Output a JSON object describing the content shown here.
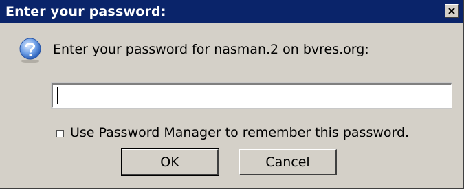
{
  "window": {
    "title": "Enter your password:",
    "close_icon": "close-icon"
  },
  "prompt": {
    "icon": "question-icon",
    "text": "Enter your password for nasman.2 on bvres.org:"
  },
  "password_field": {
    "value": "",
    "placeholder": ""
  },
  "remember": {
    "label": "Use Password Manager to remember this password.",
    "checked": false
  },
  "buttons": {
    "ok": "OK",
    "cancel": "Cancel"
  },
  "colors": {
    "title_bar": "#0a246a",
    "dialog_bg": "#d4d0c8",
    "icon_blue": "#3a78d8"
  }
}
